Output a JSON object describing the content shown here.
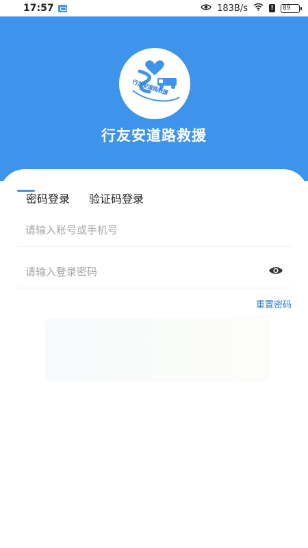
{
  "status_bar": {
    "time": "17:57",
    "speed": "183B/s",
    "battery": "89",
    "alert": "!"
  },
  "app": {
    "title": "行友安道路救援",
    "logo_text": "行友安道路救援",
    "brand_color": "#3e94ea"
  },
  "login": {
    "tabs": [
      {
        "label": "密码登录",
        "active": true
      },
      {
        "label": "验证码登录",
        "active": false
      }
    ],
    "account_placeholder": "请输入账号或手机号",
    "password_placeholder": "请输入登录密码",
    "reset_label": "重置密码"
  },
  "icons": {
    "status_eye": "eye-icon",
    "wifi": "wifi-icon",
    "password_toggle": "eye-icon"
  }
}
